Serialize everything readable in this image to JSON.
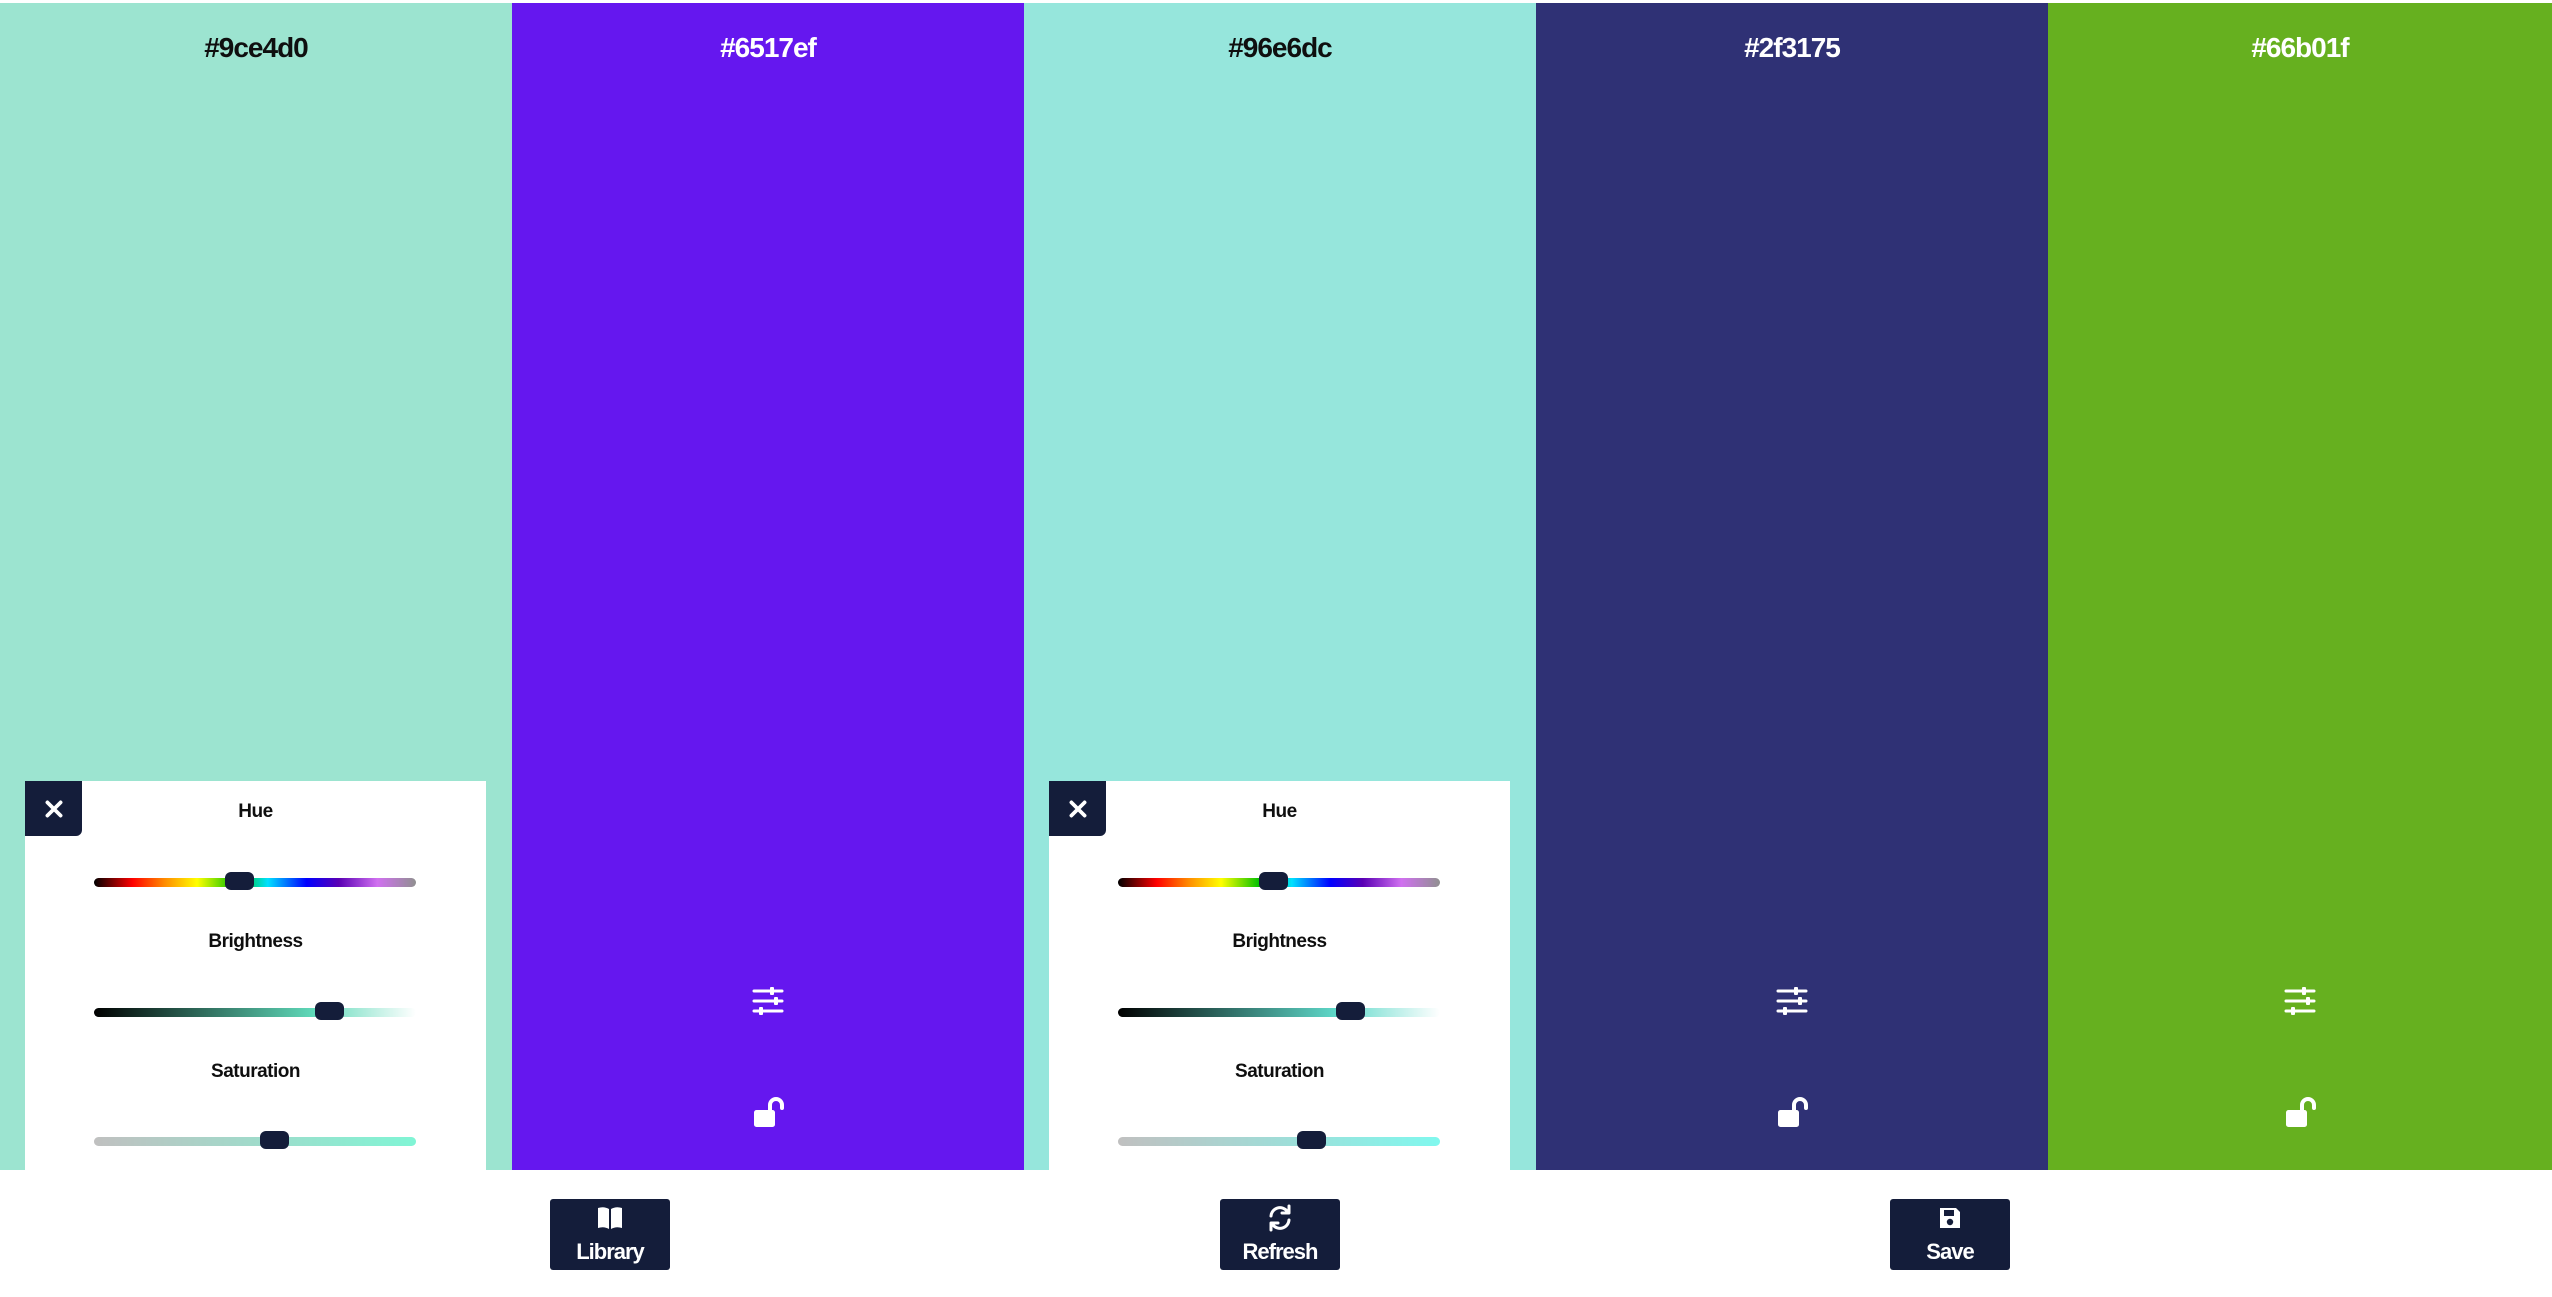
{
  "palette": {
    "colors": [
      {
        "hex": "#9ce4d0",
        "hex_label": "#9ce4d0",
        "text_tone": "dark"
      },
      {
        "hex": "#6517ef",
        "hex_label": "#6517ef",
        "text_tone": "light"
      },
      {
        "hex": "#96e6dc",
        "hex_label": "#96e6dc",
        "text_tone": "dark"
      },
      {
        "hex": "#2f3175",
        "hex_label": "#2f3175",
        "text_tone": "light"
      },
      {
        "hex": "#66b01f",
        "hex_label": "#66b01f",
        "text_tone": "light"
      }
    ],
    "icons": {
      "adjust": "sliders-icon",
      "lock": "unlocked-padlock-icon",
      "close": "close-x-icon"
    }
  },
  "adjust_panels": [
    {
      "color_index": 0,
      "hue_label": "Hue",
      "brightness_label": "Brightness",
      "saturation_label": "Saturation",
      "hue_value": 0.45,
      "brightness_value": 0.73,
      "saturation_value": 0.56,
      "brightness_gradient_end": "#5fd9b9",
      "saturation_gradient_start": "#c0c0c0",
      "saturation_gradient_end": "#80f5d5"
    },
    {
      "color_index": 2,
      "hue_label": "Hue",
      "brightness_label": "Brightness",
      "saturation_label": "Saturation",
      "hue_value": 0.48,
      "brightness_value": 0.72,
      "saturation_value": 0.6,
      "brightness_gradient_end": "#5fd9ca",
      "saturation_gradient_start": "#c0c0c0",
      "saturation_gradient_end": "#80f8ee"
    }
  ],
  "toolbar": {
    "library_label": "Library",
    "refresh_label": "Refresh",
    "save_label": "Save",
    "library_icon": "open-book-icon",
    "refresh_icon": "refresh-arrows-icon",
    "save_icon": "floppy-disk-icon"
  },
  "theme": {
    "button_color": "#141d3a"
  }
}
